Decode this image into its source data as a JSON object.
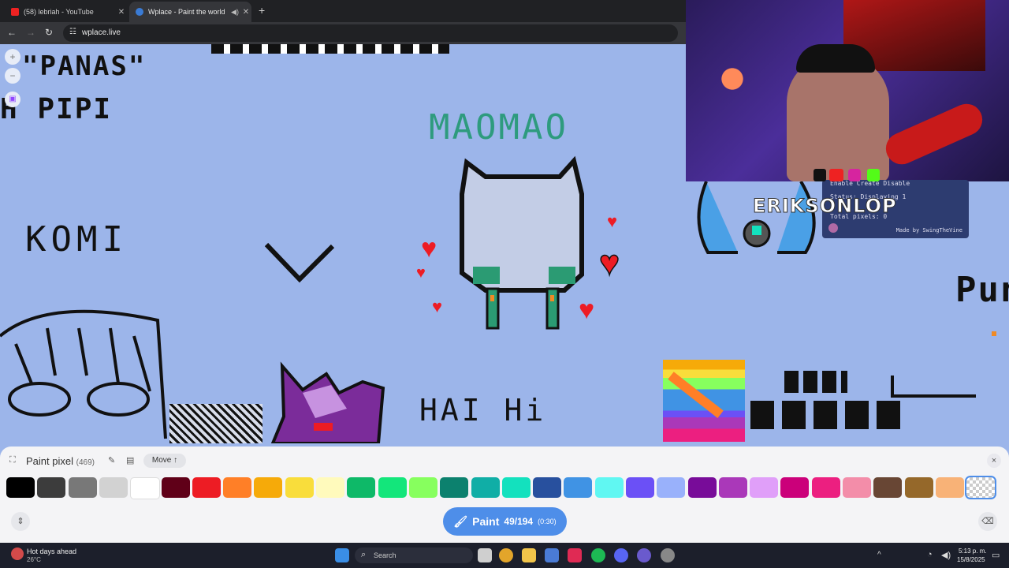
{
  "browser": {
    "tabs": [
      {
        "title": "(58) lebriah - YouTube",
        "favicon": "youtube-icon",
        "color": "#e22"
      },
      {
        "title": "Wplace - Paint the world",
        "favicon": "globe-icon",
        "color": "#3a7bd5",
        "active": true
      }
    ],
    "url": "wplace.live"
  },
  "canvas_texts": {
    "panas": "\"PANAS\"",
    "pipi": "H PIPI",
    "komi": "KOMI",
    "maomao": "MAOMAO",
    "hai": "HAI Hi",
    "pun": "Pun"
  },
  "overlay": {
    "menu": "Enable  Create  Disable",
    "status": "Status: Displaying 1",
    "pixels": "Total pixels: 0",
    "credit": "Made by SwingTheVine"
  },
  "webcam": {
    "streamer": "ERIKSONLOP"
  },
  "panel": {
    "title": "Paint pixel",
    "count": "(469)",
    "move": "Move ↑",
    "close": "×",
    "paint_label": "Paint",
    "paint_count": "49/194",
    "paint_timer": "(0:30)",
    "colors": [
      "#000000",
      "#3c3c3c",
      "#787878",
      "#d2d2d2",
      "#ffffff",
      "#600018",
      "#ed1c24",
      "#ff7f27",
      "#f6aa09",
      "#f9dd3b",
      "#fffabc",
      "#0eb968",
      "#13e67b",
      "#87ff5e",
      "#0c816e",
      "#10aea6",
      "#13e1be",
      "#28509e",
      "#4093e4",
      "#60f7f2",
      "#6b50f6",
      "#99b1fb",
      "#780c99",
      "#aa38b9",
      "#e09ff9",
      "#cb007a",
      "#ec1f80",
      "#f38da9",
      "#684634",
      "#95682a",
      "#f8b277",
      "transparent"
    ]
  },
  "taskbar": {
    "weather_title": "Hot days ahead",
    "weather_temp": "26°C",
    "search": "Search",
    "time": "5:13 p. m.",
    "date": "15/8/2025"
  }
}
